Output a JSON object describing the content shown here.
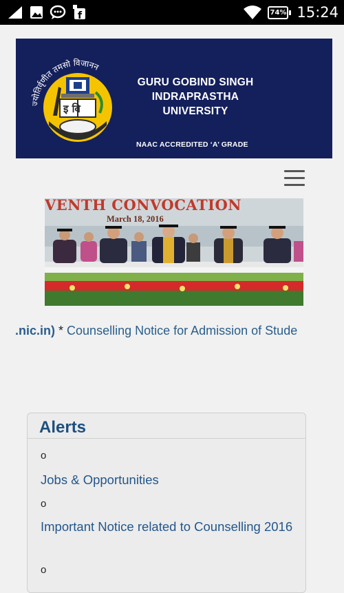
{
  "status_bar": {
    "battery": "74%",
    "time": "15:24"
  },
  "header": {
    "university_line1": "GURU GOBIND SINGH",
    "university_line2": "INDRAPRASTHA",
    "university_line3": "UNIVERSITY",
    "accreditation": "NAAC ACCREDITED ‘A’ GRADE",
    "motto": "ज्योतिर्वृणीत तमसो विजानन",
    "logo_book_text": "इ वि"
  },
  "banner": {
    "title": "VENTH CONVOCATION",
    "date": "March 18, 2016"
  },
  "ticker": {
    "prefix": "ns.nic.in)",
    "separator": " * ",
    "text": "Counselling Notice for Admission of Stude"
  },
  "alerts": {
    "title": "Alerts",
    "bullet": "o",
    "items": [
      {
        "label": "Jobs & Opportunities"
      },
      {
        "label": "Important Notice related to Counselling 2016"
      }
    ]
  },
  "colors": {
    "header_bg": "#14205c",
    "link": "#23568c",
    "alerts_title": "#1d4f7e",
    "banner_title": "#c0392b"
  }
}
